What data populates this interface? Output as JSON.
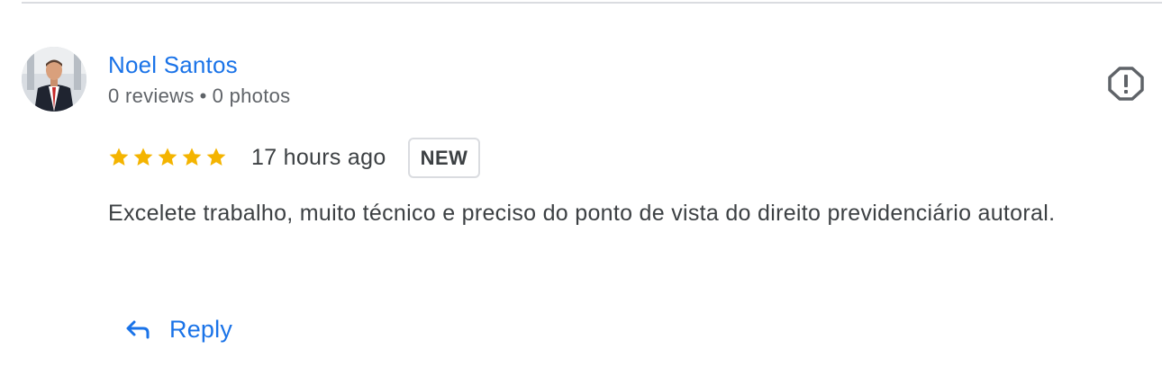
{
  "review": {
    "author": {
      "name": "Noel Santos",
      "reviews": "0 reviews",
      "separator": "•",
      "photos": "0 photos",
      "avatar_icon": "user-photo-avatar"
    },
    "rating": 5,
    "max_rating": 5,
    "time_ago": "17 hours ago",
    "badge": "NEW",
    "text": "Excelete trabalho, muito técnico e preciso do ponto de vista do direito previdenciário autoral.",
    "flag_icon": "report-flag-icon",
    "reply_icon": "reply-arrow-icon",
    "reply_label": "Reply"
  },
  "colors": {
    "link_blue": "#1a73e8",
    "star_gold": "#f4b400",
    "text_primary": "#3c4043",
    "text_secondary": "#5f6368",
    "divider": "#dadce0",
    "icon_gray": "#5f6368"
  }
}
